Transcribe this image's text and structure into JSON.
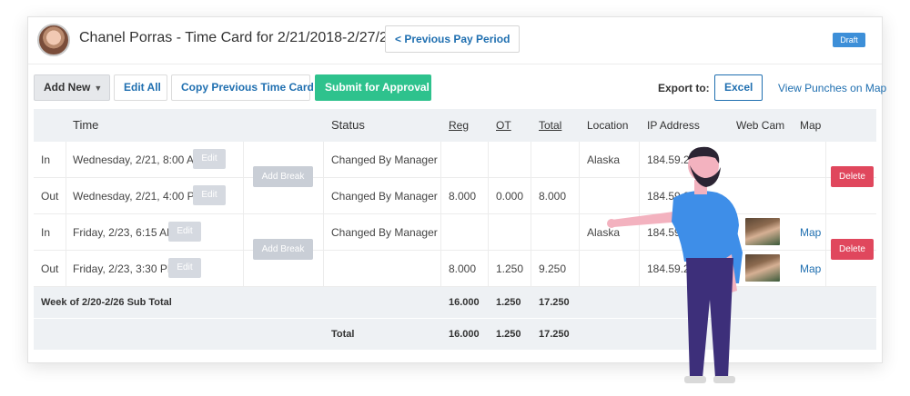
{
  "header": {
    "title": "Chanel Porras - Time Card for 2/21/2018-2/27/2018",
    "prev_label": "< Previous Pay Period",
    "badge": "Draft"
  },
  "toolbar": {
    "add_new": "Add New",
    "edit_all": "Edit All",
    "copy_prev": "Copy Previous Time Card",
    "submit": "Submit for Approval",
    "export_label": "Export to:",
    "excel": "Excel",
    "map_link": "View Punches on Map"
  },
  "columns": {
    "time": "Time",
    "status": "Status",
    "reg": "Reg",
    "ot": "OT",
    "total": "Total",
    "location": "Location",
    "ip": "IP Address",
    "webcam": "Web Cam",
    "map": "Map"
  },
  "rows": [
    {
      "type": "In",
      "time": "Wednesday, 2/21, 8:00 AM",
      "edit": "Edit",
      "status": "Changed By Manager",
      "reg": "",
      "ot": "",
      "total": "",
      "location": "Alaska",
      "ip": "184.59.21",
      "map": ""
    },
    {
      "type": "Out",
      "time": "Wednesday, 2/21, 4:00 PM",
      "edit": "Edit",
      "status": "Changed By Manager",
      "reg": "8.000",
      "ot": "0.000",
      "total": "8.000",
      "location": "",
      "ip": "184.59.21",
      "map": ""
    },
    {
      "type": "In",
      "time": "Friday, 2/23, 6:15 AM",
      "edit": "Edit",
      "status": "Changed By Manager",
      "reg": "",
      "ot": "",
      "total": "",
      "location": "Alaska",
      "ip": "184.59.21",
      "map": "Map"
    },
    {
      "type": "Out",
      "time": "Friday, 2/23, 3:30 PM",
      "edit": "Edit",
      "status": "",
      "reg": "8.000",
      "ot": "1.250",
      "total": "9.250",
      "location": "",
      "ip": "184.59.21",
      "map": "Map"
    }
  ],
  "buttons": {
    "add_break": "Add Break",
    "delete": "Delete"
  },
  "subtotal": {
    "label": "Week of 2/20-2/26 Sub Total",
    "reg": "16.000",
    "ot": "1.250",
    "total": "17.250"
  },
  "grand_total": {
    "label": "Total",
    "reg": "16.000",
    "ot": "1.250",
    "total": "17.250"
  },
  "colors": {
    "accent": "#1f6fb0",
    "submit": "#2ec28d",
    "delete": "#e0475d",
    "draft": "#3d8fd8"
  },
  "icons": {
    "avatar": "user-avatar",
    "chevron": "chevron-down-icon"
  }
}
